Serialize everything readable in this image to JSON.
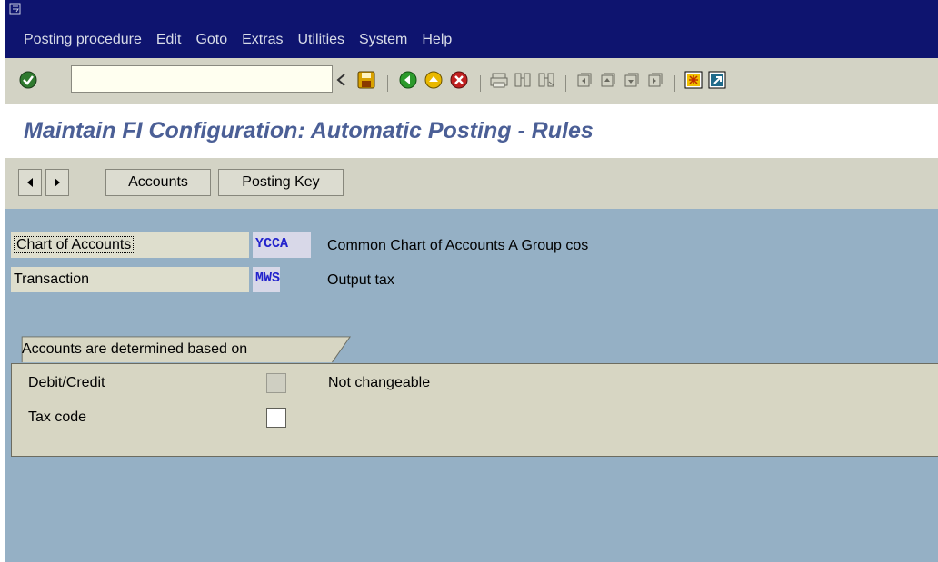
{
  "menubar": {
    "items": [
      "Posting procedure",
      "Edit",
      "Goto",
      "Extras",
      "Utilities",
      "System",
      "Help"
    ]
  },
  "toolbar": {
    "command_value": "",
    "icons": [
      "enter-icon",
      "command-history-icon",
      "back-arrow-icon",
      "save-icon",
      "back-icon",
      "exit-icon",
      "cancel-icon",
      "print-icon",
      "find-icon",
      "find-next-icon",
      "first-page-icon",
      "previous-page-icon",
      "next-page-icon",
      "last-page-icon",
      "create-session-icon",
      "shortcut-icon"
    ]
  },
  "screen": {
    "title": "Maintain FI Configuration: Automatic Posting - Rules"
  },
  "app_toolbar": {
    "accounts_label": "Accounts",
    "posting_key_label": "Posting Key"
  },
  "fields": {
    "chart_of_accounts": {
      "label": "Chart of Accounts",
      "value": "YCCA",
      "description": "Common Chart of Accounts A Group cos"
    },
    "transaction": {
      "label": "Transaction",
      "value": "MWS",
      "description": "Output tax"
    }
  },
  "group": {
    "title": "Accounts are determined based on",
    "debit_credit": {
      "label": "Debit/Credit",
      "checked": false,
      "note": "Not changeable"
    },
    "tax_code": {
      "label": "Tax code",
      "checked": false
    }
  },
  "colors": {
    "menubar_bg": "#0e146f",
    "toolbar_bg": "#d3d3c5",
    "screen_bg": "#95b0c5",
    "title_text": "#4b5f96"
  }
}
